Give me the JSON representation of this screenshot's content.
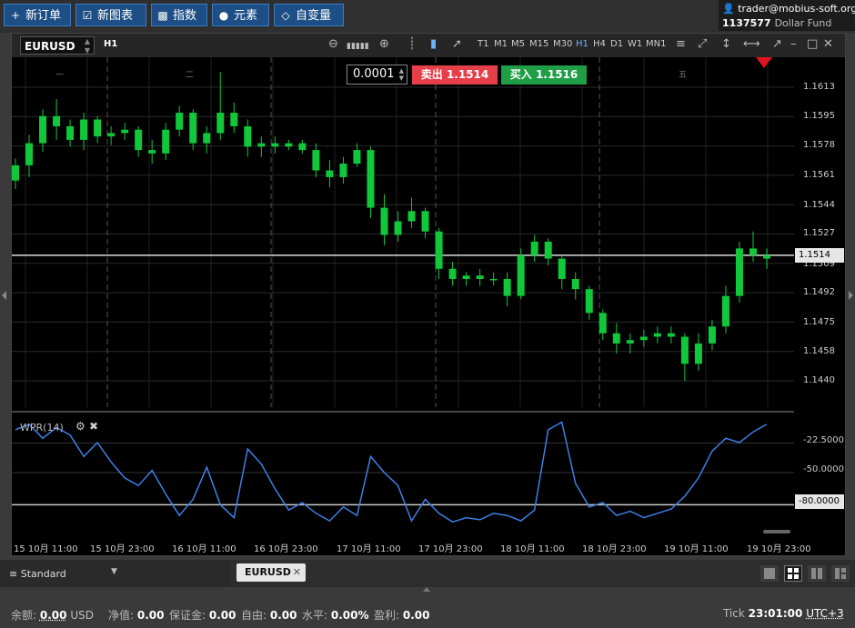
{
  "toolbar": {
    "buttons": [
      {
        "id": "new-order",
        "icon": "plus-icon",
        "label": "新订单"
      },
      {
        "id": "new-chart",
        "icon": "chart-check-icon",
        "label": "新图表"
      },
      {
        "id": "indicators",
        "icon": "bar-chart-icon",
        "label": "指数"
      },
      {
        "id": "elements",
        "icon": "shapes-icon",
        "label": "元素"
      },
      {
        "id": "variables",
        "icon": "diamond-icon",
        "label": "自变量"
      }
    ]
  },
  "account": {
    "user": "trader@mobius-soft.org",
    "number": "1137577",
    "type": "Dollar Fund"
  },
  "chart": {
    "symbol": "EURUSD",
    "timeframe": "H1",
    "timeframes": [
      "T1",
      "M1",
      "M5",
      "M15",
      "M30",
      "H1",
      "H4",
      "D1",
      "W1",
      "MN1"
    ],
    "active_timeframe": "H1",
    "lot": "0.0001",
    "sell_label": "卖出",
    "sell_price": "1.1514",
    "buy_label": "买入",
    "buy_price": "1.1516",
    "current_price": "1.1514",
    "price_ticks": [
      "1.1613",
      "1.1595",
      "1.1578",
      "1.1561",
      "1.1544",
      "1.1527",
      "1.1509",
      "1.1492",
      "1.1475",
      "1.1458",
      "1.1440"
    ],
    "day_labels": [
      "一",
      "二",
      "五"
    ],
    "indicator": {
      "name": "WPR(14)",
      "levels": [
        "-22.5000",
        "-50.0000"
      ],
      "current_level": "-80.0000"
    },
    "time_ticks": [
      "15 10月 11:00",
      "15 10月 23:00",
      "16 10月 11:00",
      "16 10月 23:00",
      "17 10月 11:00",
      "17 10月 23:00",
      "18 10月 11:00",
      "18 10月 23:00",
      "19 10月 11:00",
      "19 10月 23:00"
    ],
    "colors": {
      "bull": "#10c83a",
      "line": "#3f7fe6",
      "sell": "#e5404a",
      "buy": "#1f9e45"
    }
  },
  "bottom": {
    "profile": "Standard",
    "tab": "EURUSD"
  },
  "status": {
    "balance_label": "余额:",
    "balance_value": "0.00",
    "currency": "USD",
    "equity_label": "净值:",
    "equity_value": "0.00",
    "margin_label": "保证金:",
    "margin_value": "0.00",
    "free_label": "自由:",
    "free_value": "0.00",
    "level_label": "水平:",
    "level_value": "0.00%",
    "profit_label": "盈利:",
    "profit_value": "0.00",
    "tick_label": "Tick",
    "time": "23:01:00",
    "timezone": "UTC+3"
  },
  "chart_data": {
    "type": "candlestick",
    "candles": [
      [
        1.1558,
        1.1571,
        1.1553,
        1.1567
      ],
      [
        1.1567,
        1.1585,
        1.156,
        1.158
      ],
      [
        1.158,
        1.16,
        1.1575,
        1.1596
      ],
      [
        1.1596,
        1.1606,
        1.1582,
        1.159
      ],
      [
        1.159,
        1.1594,
        1.1578,
        1.1582
      ],
      [
        1.1582,
        1.1598,
        1.1576,
        1.1594
      ],
      [
        1.1594,
        1.1596,
        1.158,
        1.1584
      ],
      [
        1.1584,
        1.159,
        1.1579,
        1.1586
      ],
      [
        1.1586,
        1.1592,
        1.1582,
        1.1588
      ],
      [
        1.1588,
        1.159,
        1.1572,
        1.1576
      ],
      [
        1.1576,
        1.1582,
        1.1568,
        1.1574
      ],
      [
        1.1574,
        1.1592,
        1.157,
        1.1588
      ],
      [
        1.1588,
        1.1602,
        1.1584,
        1.1598
      ],
      [
        1.1598,
        1.16,
        1.1576,
        1.158
      ],
      [
        1.158,
        1.159,
        1.1574,
        1.1586
      ],
      [
        1.1586,
        1.1622,
        1.1582,
        1.1598
      ],
      [
        1.1598,
        1.1604,
        1.1586,
        1.159
      ],
      [
        1.159,
        1.1594,
        1.1572,
        1.1578
      ],
      [
        1.1578,
        1.1584,
        1.1572,
        1.158
      ],
      [
        1.158,
        1.1584,
        1.1574,
        1.1578
      ],
      [
        1.1578,
        1.1582,
        1.1576,
        1.158
      ],
      [
        1.158,
        1.1582,
        1.1574,
        1.1576
      ],
      [
        1.1576,
        1.158,
        1.156,
        1.1564
      ],
      [
        1.1564,
        1.157,
        1.1554,
        1.156
      ],
      [
        1.156,
        1.1572,
        1.1556,
        1.1568
      ],
      [
        1.1568,
        1.158,
        1.1566,
        1.1576
      ],
      [
        1.1576,
        1.1578,
        1.1536,
        1.1542
      ],
      [
        1.1542,
        1.155,
        1.152,
        1.1526
      ],
      [
        1.1526,
        1.154,
        1.1522,
        1.1534
      ],
      [
        1.1534,
        1.1548,
        1.153,
        1.154
      ],
      [
        1.154,
        1.1542,
        1.1524,
        1.1528
      ],
      [
        1.1528,
        1.153,
        1.15,
        1.1506
      ],
      [
        1.1506,
        1.151,
        1.1496,
        1.15
      ],
      [
        1.15,
        1.1504,
        1.1496,
        1.1502
      ],
      [
        1.1502,
        1.1506,
        1.1496,
        1.15
      ],
      [
        1.15,
        1.1504,
        1.1496,
        1.15
      ],
      [
        1.15,
        1.1504,
        1.1484,
        1.149
      ],
      [
        1.149,
        1.1518,
        1.1488,
        1.1514
      ],
      [
        1.1514,
        1.1526,
        1.151,
        1.1522
      ],
      [
        1.1522,
        1.1524,
        1.1508,
        1.1512
      ],
      [
        1.1512,
        1.1514,
        1.1494,
        1.15
      ],
      [
        1.15,
        1.1504,
        1.1488,
        1.1494
      ],
      [
        1.1494,
        1.1496,
        1.1476,
        1.148
      ],
      [
        1.148,
        1.1482,
        1.1464,
        1.1468
      ],
      [
        1.1468,
        1.1474,
        1.1456,
        1.1462
      ],
      [
        1.1462,
        1.1468,
        1.1456,
        1.1464
      ],
      [
        1.1464,
        1.147,
        1.146,
        1.1466
      ],
      [
        1.1466,
        1.1472,
        1.1462,
        1.1468
      ],
      [
        1.1468,
        1.1472,
        1.1462,
        1.1466
      ],
      [
        1.1466,
        1.1468,
        1.144,
        1.145
      ],
      [
        1.145,
        1.1468,
        1.1446,
        1.1462
      ],
      [
        1.1462,
        1.1476,
        1.1458,
        1.1472
      ],
      [
        1.1472,
        1.1496,
        1.1468,
        1.149
      ],
      [
        1.149,
        1.1522,
        1.1486,
        1.1518
      ],
      [
        1.1518,
        1.1528,
        1.151,
        1.1514
      ],
      [
        1.1514,
        1.1518,
        1.1506,
        1.1512
      ]
    ],
    "wpr": [
      -10,
      -5,
      -18,
      -8,
      -15,
      -35,
      -22,
      -40,
      -55,
      -62,
      -48,
      -70,
      -90,
      -75,
      -45,
      -80,
      -92,
      -28,
      -42,
      -65,
      -85,
      -78,
      -88,
      -95,
      -82,
      -90,
      -35,
      -50,
      -62,
      -95,
      -75,
      -88,
      -96,
      -92,
      -94,
      -88,
      -90,
      -95,
      -85,
      -10,
      -3,
      -60,
      -82,
      -78,
      -90,
      -86,
      -92,
      -88,
      -84,
      -72,
      -55,
      -30,
      -18,
      -22,
      -12,
      -5
    ]
  }
}
